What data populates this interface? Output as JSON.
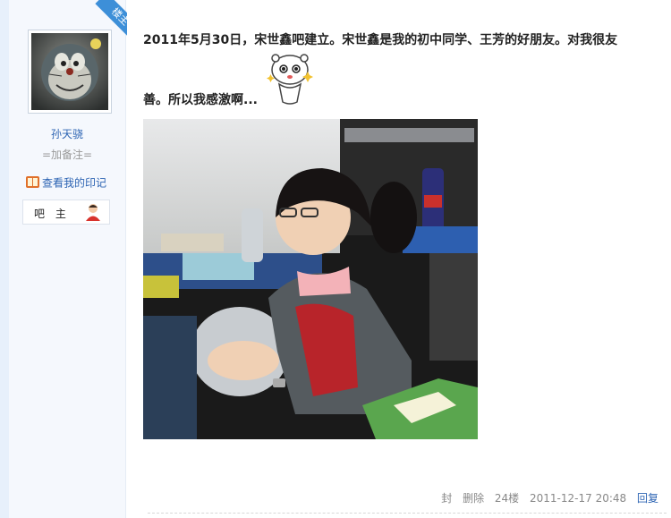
{
  "sidebar": {
    "floor_owner_badge": "楼主",
    "username": "孙天骁",
    "remark": "=加备注=",
    "view_marks": "查看我的印记",
    "role": "吧 主"
  },
  "post": {
    "text_line1": "2011年5月30日，宋世鑫吧建立。宋世鑫是我的初中同学、王芳的好朋友。对我很友",
    "text_line2": "善。所以我感激啊..."
  },
  "footer": {
    "block": "封",
    "delete": "删除",
    "floor": "24楼",
    "timestamp": "2011-12-17 20:48",
    "reply": "回复"
  },
  "colors": {
    "link": "#2d64b3",
    "badge": "#3d8fd8",
    "sidebar_bg": "#f5f8fd"
  }
}
